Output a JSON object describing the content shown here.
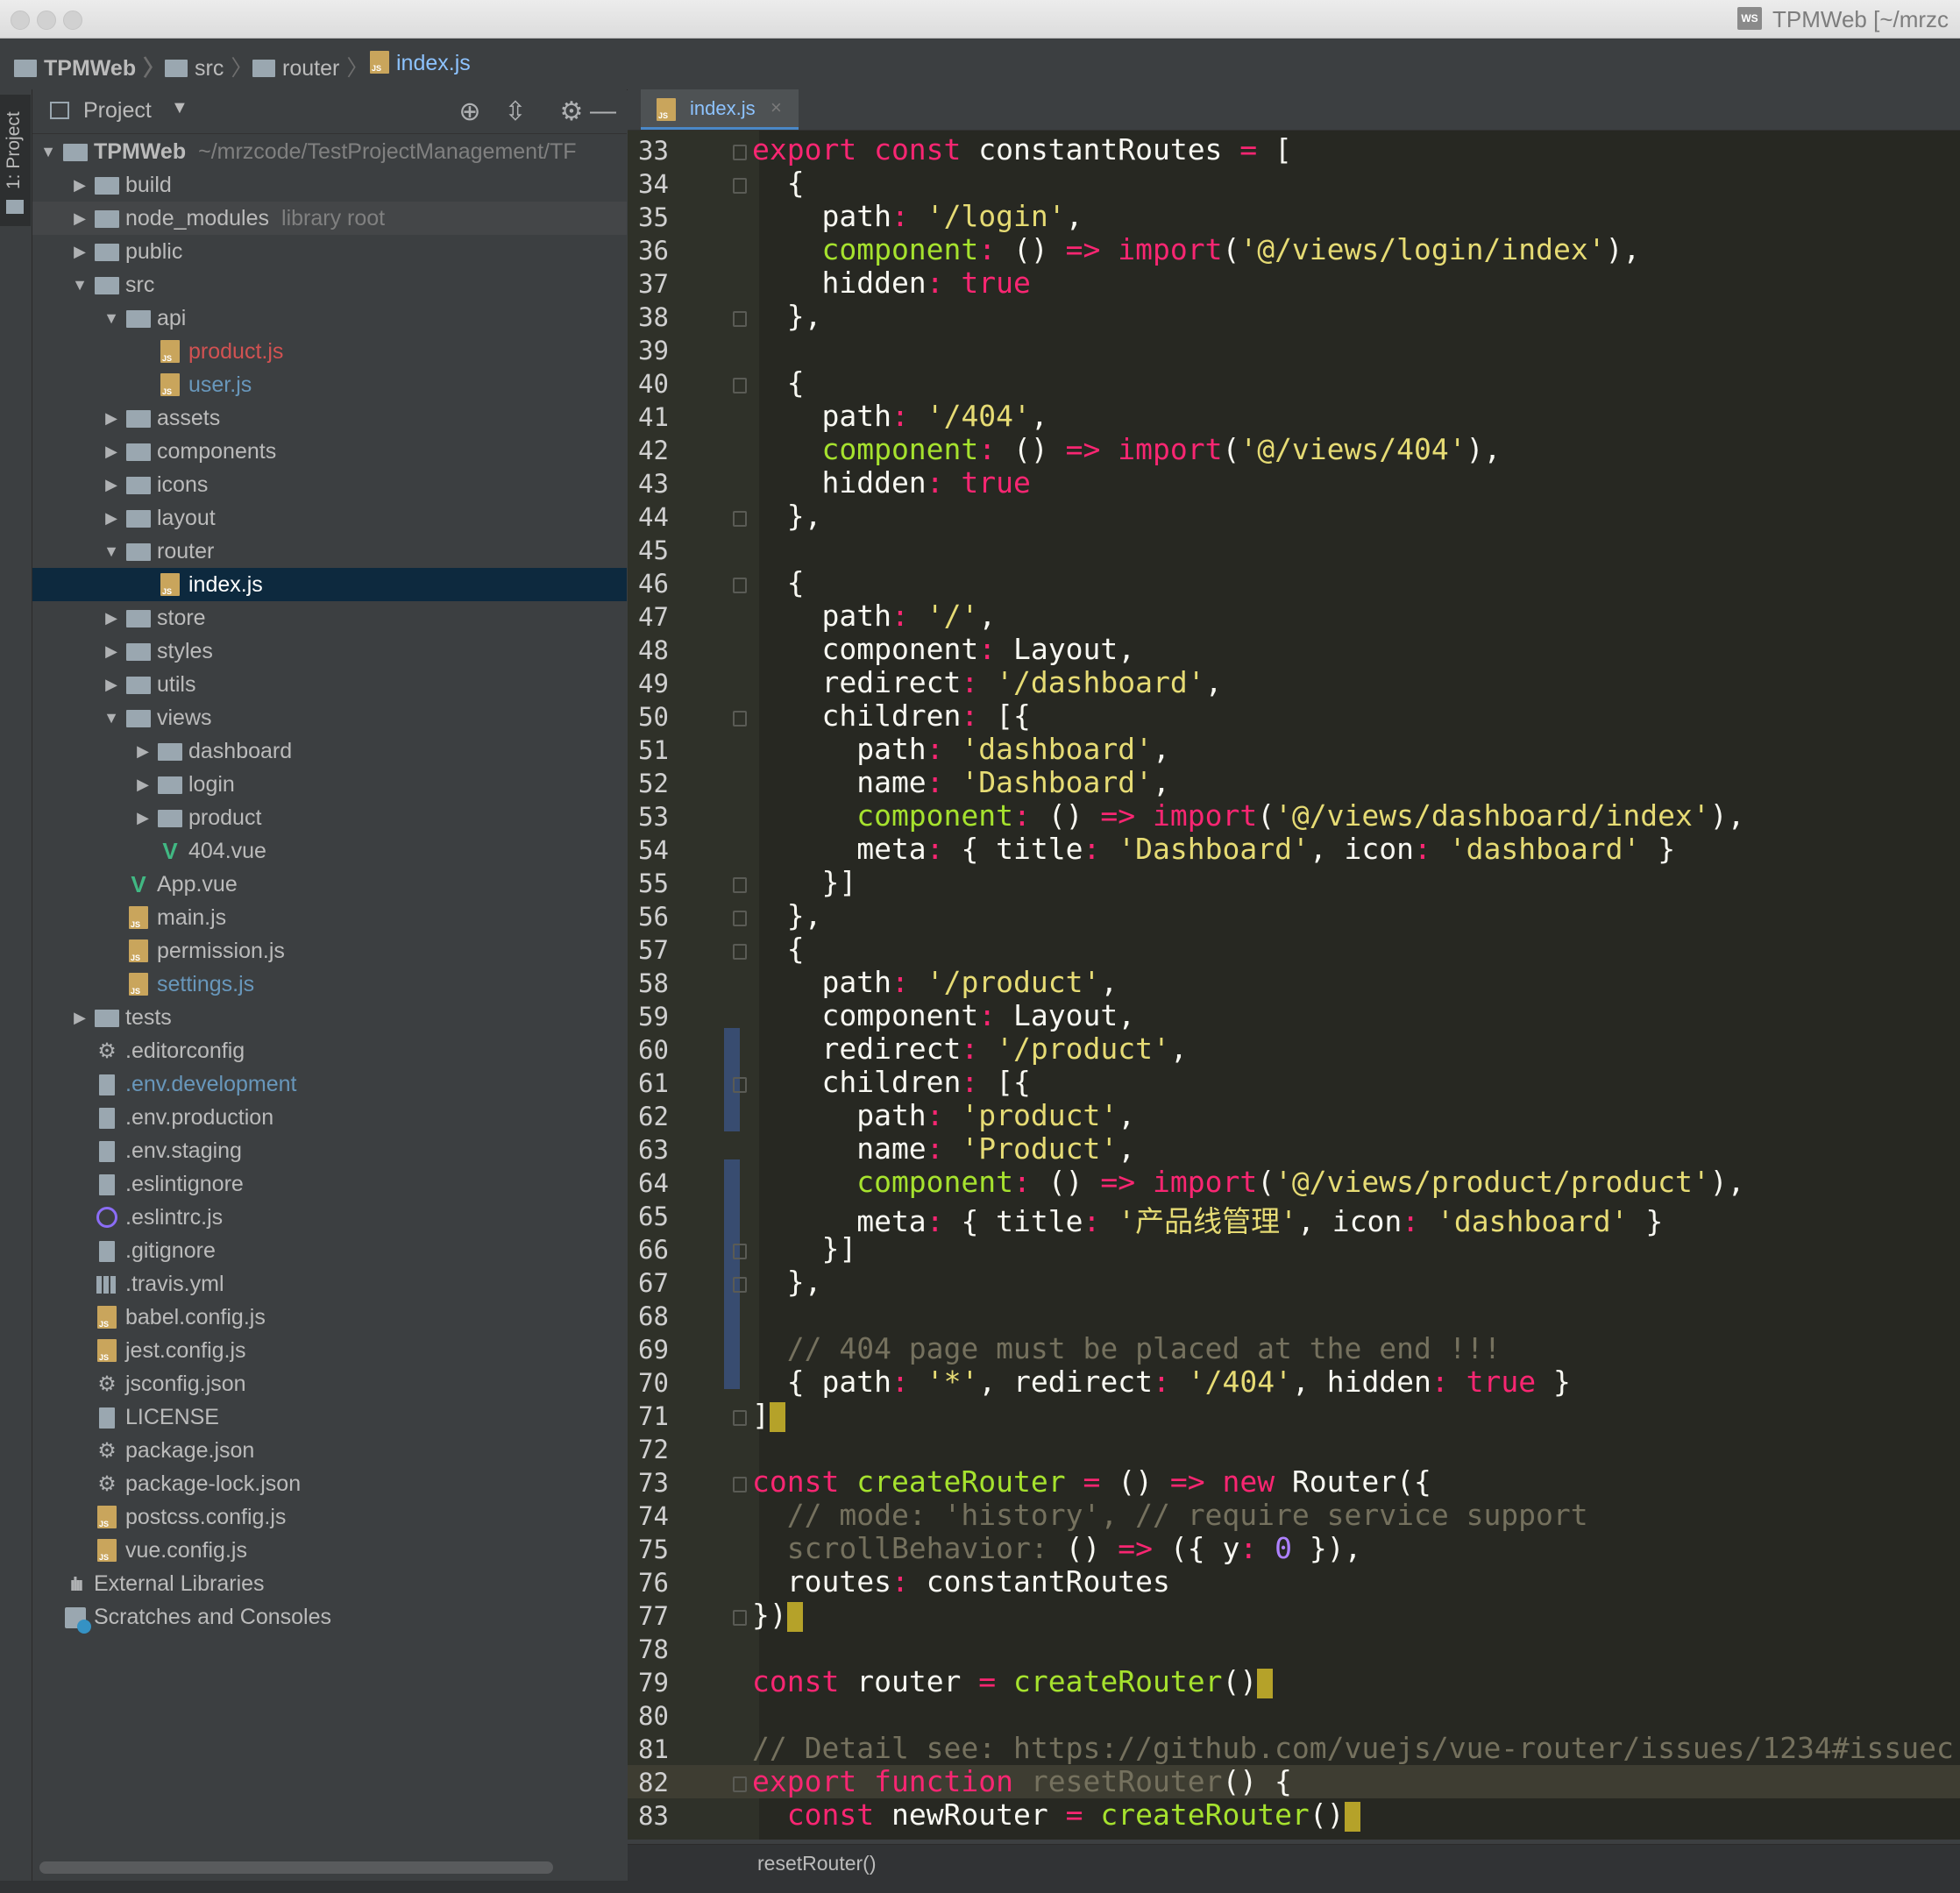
{
  "window": {
    "title": "TPMWeb [~/mrzcode/TestProjectManagement/TPMWeb] - .../src/router/index.js [TPMWeb]",
    "title_visible": "TPMWeb [~/mrzc"
  },
  "navbar": {
    "crumbs": [
      "TPMWeb",
      "src",
      "router",
      "index.js"
    ]
  },
  "toolstrip": {
    "label": "1: Project"
  },
  "project": {
    "header_label": "Project",
    "tree": [
      {
        "label": "TPMWeb",
        "hint": "~/mrzcode/TestProjectManagement/TF",
        "depth": 0,
        "kind": "folder",
        "open": true,
        "bold": true
      },
      {
        "label": "build",
        "depth": 1,
        "kind": "folder",
        "open": false
      },
      {
        "label": "node_modules",
        "hint": "library root",
        "depth": 1,
        "kind": "folder",
        "open": false,
        "hl": true
      },
      {
        "label": "public",
        "depth": 1,
        "kind": "folder",
        "open": false
      },
      {
        "label": "src",
        "depth": 1,
        "kind": "folder",
        "open": true
      },
      {
        "label": "api",
        "depth": 2,
        "kind": "folder",
        "open": true
      },
      {
        "label": "product.js",
        "depth": 3,
        "kind": "js",
        "color": "red"
      },
      {
        "label": "user.js",
        "depth": 3,
        "kind": "js",
        "color": "blue"
      },
      {
        "label": "assets",
        "depth": 2,
        "kind": "folder",
        "open": false
      },
      {
        "label": "components",
        "depth": 2,
        "kind": "folder",
        "open": false
      },
      {
        "label": "icons",
        "depth": 2,
        "kind": "folder",
        "open": false
      },
      {
        "label": "layout",
        "depth": 2,
        "kind": "folder",
        "open": false
      },
      {
        "label": "router",
        "depth": 2,
        "kind": "folder",
        "open": true
      },
      {
        "label": "index.js",
        "depth": 3,
        "kind": "js",
        "selected": true
      },
      {
        "label": "store",
        "depth": 2,
        "kind": "folder",
        "open": false
      },
      {
        "label": "styles",
        "depth": 2,
        "kind": "folder",
        "open": false
      },
      {
        "label": "utils",
        "depth": 2,
        "kind": "folder",
        "open": false
      },
      {
        "label": "views",
        "depth": 2,
        "kind": "folder",
        "open": true
      },
      {
        "label": "dashboard",
        "depth": 3,
        "kind": "folder",
        "open": false
      },
      {
        "label": "login",
        "depth": 3,
        "kind": "folder",
        "open": false
      },
      {
        "label": "product",
        "depth": 3,
        "kind": "folder",
        "open": false
      },
      {
        "label": "404.vue",
        "depth": 3,
        "kind": "vue"
      },
      {
        "label": "App.vue",
        "depth": 2,
        "kind": "vue"
      },
      {
        "label": "main.js",
        "depth": 2,
        "kind": "js"
      },
      {
        "label": "permission.js",
        "depth": 2,
        "kind": "js"
      },
      {
        "label": "settings.js",
        "depth": 2,
        "kind": "js",
        "color": "blue"
      },
      {
        "label": "tests",
        "depth": 1,
        "kind": "folder",
        "open": false
      },
      {
        "label": ".editorconfig",
        "depth": 1,
        "kind": "gear"
      },
      {
        "label": ".env.development",
        "depth": 1,
        "kind": "txt",
        "color": "blue"
      },
      {
        "label": ".env.production",
        "depth": 1,
        "kind": "txt"
      },
      {
        "label": ".env.staging",
        "depth": 1,
        "kind": "txt"
      },
      {
        "label": ".eslintignore",
        "depth": 1,
        "kind": "txt"
      },
      {
        "label": ".eslintrc.js",
        "depth": 1,
        "kind": "circle"
      },
      {
        "label": ".gitignore",
        "depth": 1,
        "kind": "txt"
      },
      {
        "label": ".travis.yml",
        "depth": 1,
        "kind": "table"
      },
      {
        "label": "babel.config.js",
        "depth": 1,
        "kind": "js"
      },
      {
        "label": "jest.config.js",
        "depth": 1,
        "kind": "js"
      },
      {
        "label": "jsconfig.json",
        "depth": 1,
        "kind": "gear"
      },
      {
        "label": "LICENSE",
        "depth": 1,
        "kind": "txt"
      },
      {
        "label": "package.json",
        "depth": 1,
        "kind": "gear"
      },
      {
        "label": "package-lock.json",
        "depth": 1,
        "kind": "gear"
      },
      {
        "label": "postcss.config.js",
        "depth": 1,
        "kind": "js"
      },
      {
        "label": "vue.config.js",
        "depth": 1,
        "kind": "js"
      },
      {
        "label": "External Libraries",
        "depth": 0,
        "kind": "lib"
      },
      {
        "label": "Scratches and Consoles",
        "depth": 0,
        "kind": "scratch"
      }
    ]
  },
  "editor": {
    "tab_label": "index.js",
    "current_line": 82,
    "lines": [
      {
        "n": 33,
        "t": [
          [
            "k",
            "export const "
          ],
          [
            "p",
            "constantRoutes "
          ],
          [
            "k",
            "= "
          ],
          [
            "p",
            "["
          ]
        ]
      },
      {
        "n": 34,
        "t": [
          [
            "p",
            "  {"
          ]
        ]
      },
      {
        "n": 35,
        "t": [
          [
            "p",
            "    path"
          ],
          [
            "k",
            ": "
          ],
          [
            "s",
            "'/login'"
          ],
          [
            "p",
            ","
          ]
        ]
      },
      {
        "n": 36,
        "t": [
          [
            "g",
            "    component"
          ],
          [
            "k",
            ": "
          ],
          [
            "p",
            "() "
          ],
          [
            "k",
            "=> import"
          ],
          [
            "p",
            "("
          ],
          [
            "s",
            "'@/views/login/index'"
          ],
          [
            "p",
            "),"
          ]
        ]
      },
      {
        "n": 37,
        "t": [
          [
            "p",
            "    hidden"
          ],
          [
            "k",
            ": true"
          ]
        ]
      },
      {
        "n": 38,
        "t": [
          [
            "p",
            "  },"
          ]
        ]
      },
      {
        "n": 39,
        "t": []
      },
      {
        "n": 40,
        "t": [
          [
            "p",
            "  {"
          ]
        ]
      },
      {
        "n": 41,
        "t": [
          [
            "p",
            "    path"
          ],
          [
            "k",
            ": "
          ],
          [
            "s",
            "'/404'"
          ],
          [
            "p",
            ","
          ]
        ]
      },
      {
        "n": 42,
        "t": [
          [
            "g",
            "    component"
          ],
          [
            "k",
            ": "
          ],
          [
            "p",
            "() "
          ],
          [
            "k",
            "=> import"
          ],
          [
            "p",
            "("
          ],
          [
            "s",
            "'@/views/404'"
          ],
          [
            "p",
            "),"
          ]
        ]
      },
      {
        "n": 43,
        "t": [
          [
            "p",
            "    hidden"
          ],
          [
            "k",
            ": true"
          ]
        ]
      },
      {
        "n": 44,
        "t": [
          [
            "p",
            "  },"
          ]
        ]
      },
      {
        "n": 45,
        "t": []
      },
      {
        "n": 46,
        "t": [
          [
            "p",
            "  {"
          ]
        ]
      },
      {
        "n": 47,
        "t": [
          [
            "p",
            "    path"
          ],
          [
            "k",
            ": "
          ],
          [
            "s",
            "'/'"
          ],
          [
            "p",
            ","
          ]
        ]
      },
      {
        "n": 48,
        "t": [
          [
            "p",
            "    component"
          ],
          [
            "k",
            ": "
          ],
          [
            "p",
            "Layout,"
          ]
        ]
      },
      {
        "n": 49,
        "t": [
          [
            "p",
            "    redirect"
          ],
          [
            "k",
            ": "
          ],
          [
            "s",
            "'/dashboard'"
          ],
          [
            "p",
            ","
          ]
        ]
      },
      {
        "n": 50,
        "t": [
          [
            "p",
            "    children"
          ],
          [
            "k",
            ": "
          ],
          [
            "p",
            "[{"
          ]
        ]
      },
      {
        "n": 51,
        "t": [
          [
            "p",
            "      path"
          ],
          [
            "k",
            ": "
          ],
          [
            "s",
            "'dashboard'"
          ],
          [
            "p",
            ","
          ]
        ]
      },
      {
        "n": 52,
        "t": [
          [
            "p",
            "      name"
          ],
          [
            "k",
            ": "
          ],
          [
            "s",
            "'Dashboard'"
          ],
          [
            "p",
            ","
          ]
        ]
      },
      {
        "n": 53,
        "t": [
          [
            "g",
            "      component"
          ],
          [
            "k",
            ": "
          ],
          [
            "p",
            "() "
          ],
          [
            "k",
            "=> import"
          ],
          [
            "p",
            "("
          ],
          [
            "s",
            "'@/views/dashboard/index'"
          ],
          [
            "p",
            "),"
          ]
        ]
      },
      {
        "n": 54,
        "t": [
          [
            "p",
            "      meta"
          ],
          [
            "k",
            ": "
          ],
          [
            "p",
            "{ title"
          ],
          [
            "k",
            ": "
          ],
          [
            "s",
            "'Dashboard'"
          ],
          [
            "p",
            ", icon"
          ],
          [
            "k",
            ": "
          ],
          [
            "s",
            "'dashboard'"
          ],
          [
            "p",
            " }"
          ]
        ]
      },
      {
        "n": 55,
        "t": [
          [
            "p",
            "    }]"
          ]
        ]
      },
      {
        "n": 56,
        "t": [
          [
            "p",
            "  },"
          ]
        ]
      },
      {
        "n": 57,
        "t": [
          [
            "p",
            "  {"
          ]
        ]
      },
      {
        "n": 58,
        "t": [
          [
            "p",
            "    path"
          ],
          [
            "k",
            ": "
          ],
          [
            "s",
            "'/product'"
          ],
          [
            "p",
            ","
          ]
        ]
      },
      {
        "n": 59,
        "t": [
          [
            "p",
            "    component"
          ],
          [
            "k",
            ": "
          ],
          [
            "p",
            "Layout,"
          ]
        ]
      },
      {
        "n": 60,
        "t": [
          [
            "p",
            "    redirect"
          ],
          [
            "k",
            ": "
          ],
          [
            "s",
            "'/product'"
          ],
          [
            "p",
            ","
          ]
        ]
      },
      {
        "n": 61,
        "t": [
          [
            "p",
            "    children"
          ],
          [
            "k",
            ": "
          ],
          [
            "p",
            "[{"
          ]
        ]
      },
      {
        "n": 62,
        "t": [
          [
            "p",
            "      path"
          ],
          [
            "k",
            ": "
          ],
          [
            "s",
            "'product'"
          ],
          [
            "p",
            ","
          ]
        ]
      },
      {
        "n": 63,
        "t": [
          [
            "p",
            "      name"
          ],
          [
            "k",
            ": "
          ],
          [
            "s",
            "'Product'"
          ],
          [
            "p",
            ","
          ]
        ]
      },
      {
        "n": 64,
        "t": [
          [
            "g",
            "      component"
          ],
          [
            "k",
            ": "
          ],
          [
            "p",
            "() "
          ],
          [
            "k",
            "=> import"
          ],
          [
            "p",
            "("
          ],
          [
            "s",
            "'@/views/product/product'"
          ],
          [
            "p",
            "),"
          ]
        ]
      },
      {
        "n": 65,
        "t": [
          [
            "p",
            "      meta"
          ],
          [
            "k",
            ": "
          ],
          [
            "p",
            "{ title"
          ],
          [
            "k",
            ": "
          ],
          [
            "s",
            "'产品线管理'"
          ],
          [
            "p",
            ", icon"
          ],
          [
            "k",
            ": "
          ],
          [
            "s",
            "'dashboard'"
          ],
          [
            "p",
            " }"
          ]
        ]
      },
      {
        "n": 66,
        "t": [
          [
            "p",
            "    }]"
          ]
        ]
      },
      {
        "n": 67,
        "t": [
          [
            "p",
            "  },"
          ]
        ]
      },
      {
        "n": 68,
        "t": []
      },
      {
        "n": 69,
        "t": [
          [
            "c",
            "  // 404 page must be placed at the end !!!"
          ]
        ]
      },
      {
        "n": 70,
        "t": [
          [
            "p",
            "  { path"
          ],
          [
            "k",
            ": "
          ],
          [
            "s",
            "'*'"
          ],
          [
            "p",
            ", redirect"
          ],
          [
            "k",
            ": "
          ],
          [
            "s",
            "'/404'"
          ],
          [
            "p",
            ", hidden"
          ],
          [
            "k",
            ": true"
          ],
          [
            "p",
            " }"
          ]
        ]
      },
      {
        "n": 71,
        "t": [
          [
            "p",
            "]"
          ],
          [
            "caret",
            ""
          ]
        ]
      },
      {
        "n": 72,
        "t": []
      },
      {
        "n": 73,
        "t": [
          [
            "k",
            "const "
          ],
          [
            "g",
            "createRouter "
          ],
          [
            "k",
            "= "
          ],
          [
            "p",
            "() "
          ],
          [
            "k",
            "=> new "
          ],
          [
            "p",
            "Router({"
          ]
        ]
      },
      {
        "n": 74,
        "t": [
          [
            "c",
            "  // mode: 'history', // require service support"
          ]
        ]
      },
      {
        "n": 75,
        "t": [
          [
            "c",
            "  scrollBehavior: "
          ],
          [
            "p",
            "() "
          ],
          [
            "k",
            "=> "
          ],
          [
            "p",
            "({ y"
          ],
          [
            "k",
            ": "
          ],
          [
            "n",
            "0"
          ],
          [
            "p",
            " }),"
          ]
        ]
      },
      {
        "n": 76,
        "t": [
          [
            "p",
            "  routes"
          ],
          [
            "k",
            ": "
          ],
          [
            "p",
            "constantRoutes"
          ]
        ]
      },
      {
        "n": 77,
        "t": [
          [
            "p",
            "})"
          ],
          [
            "caret",
            ""
          ]
        ]
      },
      {
        "n": 78,
        "t": []
      },
      {
        "n": 79,
        "t": [
          [
            "k",
            "const "
          ],
          [
            "p",
            "router "
          ],
          [
            "k",
            "= "
          ],
          [
            "g",
            "createRouter"
          ],
          [
            "p",
            "()"
          ],
          [
            "caret",
            ""
          ]
        ]
      },
      {
        "n": 80,
        "t": []
      },
      {
        "n": 81,
        "t": [
          [
            "c",
            "// Detail see: https://github.com/vuejs/vue-router/issues/1234#issuec"
          ]
        ]
      },
      {
        "n": 82,
        "t": [
          [
            "k",
            "export function "
          ],
          [
            "c",
            "resetRouter"
          ],
          [
            "p",
            "() {"
          ]
        ]
      },
      {
        "n": 83,
        "t": [
          [
            "k",
            "  const "
          ],
          [
            "p",
            "newRouter "
          ],
          [
            "k",
            "= "
          ],
          [
            "g",
            "createRouter"
          ],
          [
            "p",
            "()"
          ],
          [
            "caret",
            ""
          ]
        ]
      }
    ]
  },
  "breadcrumb_bottom": {
    "label": "resetRouter()"
  }
}
